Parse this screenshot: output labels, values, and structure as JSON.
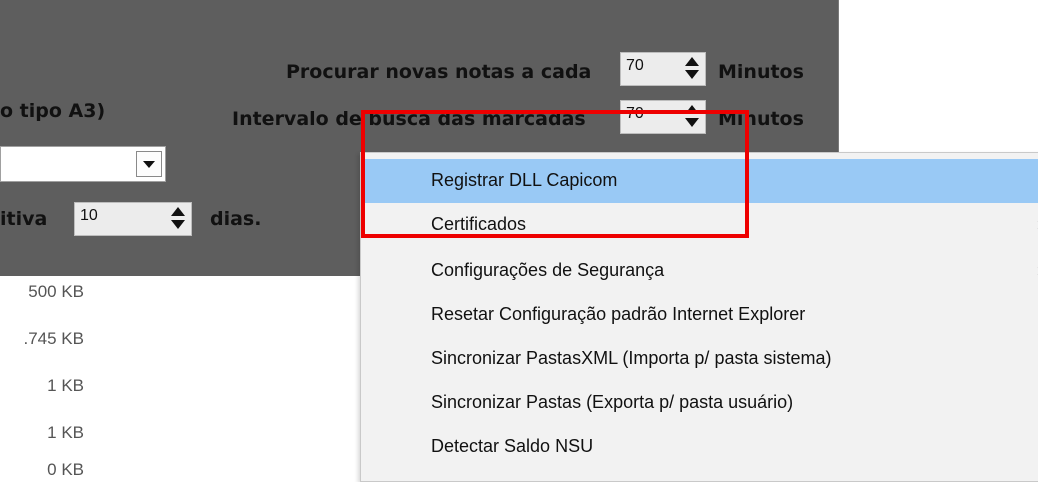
{
  "settings": {
    "search_label": "Procurar novas notas a cada",
    "search_value": "70",
    "search_unit": "Minutos",
    "interval_label": "Intervalo de busca das marcadas",
    "interval_value": "70",
    "interval_unit": "Minutos",
    "cert_type_label": "o tipo A3)",
    "retention_label": "itiva",
    "retention_value": "10",
    "retention_unit": "dias."
  },
  "file_sizes": [
    "500 KB",
    ".745 KB",
    "1 KB",
    "1 KB",
    "0 KB"
  ],
  "context_menu": {
    "items": [
      {
        "label": "Registrar DLL Capicom",
        "submenu": ""
      },
      {
        "label": "Certificados",
        "submenu": "›"
      },
      {
        "label": "Configurações de Segurança",
        "submenu": "›"
      },
      {
        "label": "Resetar Configuração padrão Internet Explorer",
        "submenu": ""
      },
      {
        "label": "Sincronizar PastasXML (Importa p/ pasta sistema)",
        "submenu": ""
      },
      {
        "label": "Sincronizar Pastas (Exporta p/ pasta usuário)",
        "submenu": ""
      },
      {
        "label": "Detectar Saldo NSU",
        "submenu": ""
      }
    ],
    "highlight_color": "#99c9f5"
  },
  "annotation_color": "#ee0000"
}
